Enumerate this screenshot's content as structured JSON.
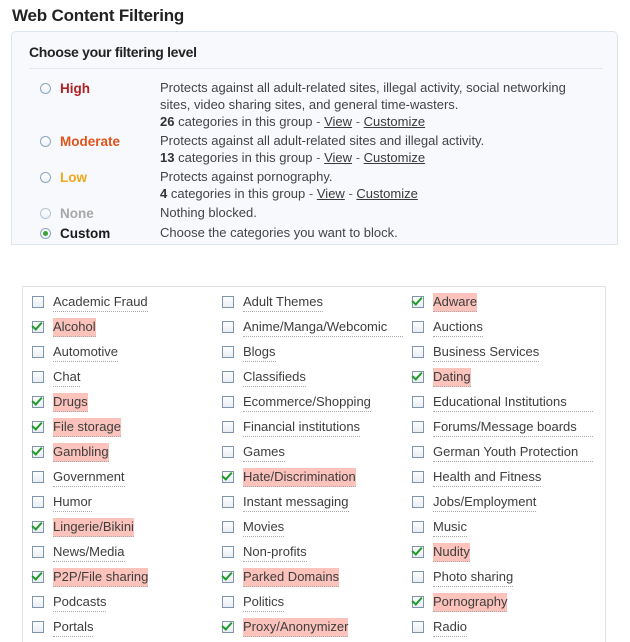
{
  "page": {
    "title": "Web Content Filtering"
  },
  "panel": {
    "heading": "Choose your filtering level"
  },
  "colors": {
    "high": "#b32020",
    "moderate": "#e0531a",
    "low": "#f0a818",
    "none": "#a8a8a8",
    "custom": "#1a1a1a",
    "highlight_bg": "#fbc3bc",
    "check_green": "#1f9b27",
    "radio_green": "#36a336",
    "panel_bg": "#f7f9fc"
  },
  "levels": [
    {
      "id": "high",
      "label": "High",
      "selected": false,
      "description": "Protects against all adult-related sites, illegal activity, social networking sites, video sharing sites, and general time-wasters.",
      "count": "26",
      "count_suffix": "categories in this group",
      "view_label": "View",
      "customize_label": "Customize",
      "separator": "-"
    },
    {
      "id": "moderate",
      "label": "Moderate",
      "selected": false,
      "description": "Protects against all adult-related sites and illegal activity.",
      "count": "13",
      "count_suffix": "categories in this group",
      "view_label": "View",
      "customize_label": "Customize",
      "separator": "-"
    },
    {
      "id": "low",
      "label": "Low",
      "selected": false,
      "description": "Protects against pornography.",
      "count": "4",
      "count_suffix": "categories in this group",
      "view_label": "View",
      "customize_label": "Customize",
      "separator": "-"
    },
    {
      "id": "none",
      "label": "None",
      "selected": false,
      "description": "Nothing blocked.",
      "count": null,
      "view_label": null,
      "customize_label": null
    },
    {
      "id": "custom",
      "label": "Custom",
      "selected": true,
      "description": "Choose the categories you want to block.",
      "count": null,
      "view_label": null,
      "customize_label": null
    }
  ],
  "categories": {
    "column1": [
      {
        "label": "Academic Fraud",
        "checked": false,
        "highlighted": false,
        "wraps": false
      },
      {
        "label": "Alcohol",
        "checked": true,
        "highlighted": true,
        "wraps": false
      },
      {
        "label": "Automotive",
        "checked": false,
        "highlighted": false,
        "wraps": false
      },
      {
        "label": "Chat",
        "checked": false,
        "highlighted": false,
        "wraps": false
      },
      {
        "label": "Drugs",
        "checked": true,
        "highlighted": true,
        "wraps": false
      },
      {
        "label": "File storage",
        "checked": true,
        "highlighted": true,
        "wraps": false
      },
      {
        "label": "Gambling",
        "checked": true,
        "highlighted": true,
        "wraps": false
      },
      {
        "label": "Government",
        "checked": false,
        "highlighted": false,
        "wraps": false
      },
      {
        "label": "Humor",
        "checked": false,
        "highlighted": false,
        "wraps": false
      },
      {
        "label": "Lingerie/Bikini",
        "checked": true,
        "highlighted": true,
        "wraps": false
      },
      {
        "label": "News/Media",
        "checked": false,
        "highlighted": false,
        "wraps": false
      },
      {
        "label": "P2P/File sharing",
        "checked": true,
        "highlighted": true,
        "wraps": false
      },
      {
        "label": "Podcasts",
        "checked": false,
        "highlighted": false,
        "wraps": false
      },
      {
        "label": "Portals",
        "checked": false,
        "highlighted": false,
        "wraps": false
      }
    ],
    "column2": [
      {
        "label": "Adult Themes",
        "checked": false,
        "highlighted": false,
        "wraps": false
      },
      {
        "label": "Anime/Manga/Webcomic",
        "checked": false,
        "highlighted": false,
        "wraps": true
      },
      {
        "label": "Blogs",
        "checked": false,
        "highlighted": false,
        "wraps": false
      },
      {
        "label": "Classifieds",
        "checked": false,
        "highlighted": false,
        "wraps": false
      },
      {
        "label": "Ecommerce/Shopping",
        "checked": false,
        "highlighted": false,
        "wraps": false
      },
      {
        "label": "Financial institutions",
        "checked": false,
        "highlighted": false,
        "wraps": false
      },
      {
        "label": "Games",
        "checked": false,
        "highlighted": false,
        "wraps": false
      },
      {
        "label": "Hate/Discrimination",
        "checked": true,
        "highlighted": true,
        "wraps": false
      },
      {
        "label": "Instant messaging",
        "checked": false,
        "highlighted": false,
        "wraps": false
      },
      {
        "label": "Movies",
        "checked": false,
        "highlighted": false,
        "wraps": false
      },
      {
        "label": "Non-profits",
        "checked": false,
        "highlighted": false,
        "wraps": false
      },
      {
        "label": "Parked Domains",
        "checked": true,
        "highlighted": true,
        "wraps": false
      },
      {
        "label": "Politics",
        "checked": false,
        "highlighted": false,
        "wraps": false
      },
      {
        "label": "Proxy/Anonymizer",
        "checked": true,
        "highlighted": true,
        "wraps": false
      }
    ],
    "column3": [
      {
        "label": "Adware",
        "checked": true,
        "highlighted": true,
        "wraps": false
      },
      {
        "label": "Auctions",
        "checked": false,
        "highlighted": false,
        "wraps": false
      },
      {
        "label": "Business Services",
        "checked": false,
        "highlighted": false,
        "wraps": false
      },
      {
        "label": "Dating",
        "checked": true,
        "highlighted": true,
        "wraps": false
      },
      {
        "label": "Educational Institutions",
        "checked": false,
        "highlighted": false,
        "wraps": true
      },
      {
        "label": "Forums/Message boards",
        "checked": false,
        "highlighted": false,
        "wraps": true
      },
      {
        "label": "German Youth Protection",
        "checked": false,
        "highlighted": false,
        "wraps": true
      },
      {
        "label": "Health and Fitness",
        "checked": false,
        "highlighted": false,
        "wraps": false
      },
      {
        "label": "Jobs/Employment",
        "checked": false,
        "highlighted": false,
        "wraps": false
      },
      {
        "label": "Music",
        "checked": false,
        "highlighted": false,
        "wraps": false
      },
      {
        "label": "Nudity",
        "checked": true,
        "highlighted": true,
        "wraps": false
      },
      {
        "label": "Photo sharing",
        "checked": false,
        "highlighted": false,
        "wraps": false
      },
      {
        "label": "Pornography",
        "checked": true,
        "highlighted": true,
        "wraps": false
      },
      {
        "label": "Radio",
        "checked": false,
        "highlighted": false,
        "wraps": false
      }
    ]
  }
}
